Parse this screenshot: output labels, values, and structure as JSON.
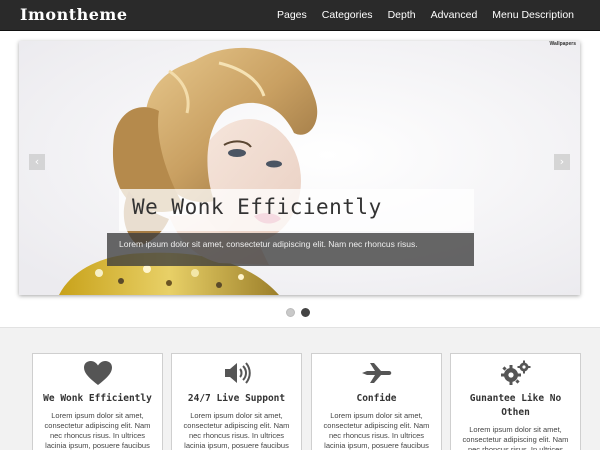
{
  "header": {
    "logo": "Imontheme",
    "nav": [
      "Pages",
      "Categories",
      "Depth",
      "Advanced",
      "Menu Description"
    ]
  },
  "slider": {
    "watermark": "Wallpapers",
    "prev_icon": "chevron-left-icon",
    "next_icon": "chevron-right-icon",
    "caption_title": "We Wonk Efficiently",
    "caption_text": "Lorem ipsum dolor sit amet, consectetur adipiscing elit. Nam nec rhoncus risus.",
    "dots": 2,
    "active_dot": 2
  },
  "services": [
    {
      "icon": "heart-icon",
      "title": "We Wonk Efficiently",
      "text": "Lorem ipsum dolor sit amet, consectetur adipiscing elit. Nam nec rhoncus risus. In ultrices lacinia ipsum, posuere faucibus velit"
    },
    {
      "icon": "speaker-icon",
      "title": "24/7 Live Suppont",
      "text": "Lorem ipsum dolor sit amet, consectetur adipiscing elit. Nam nec rhoncus risus. In ultrices lacinia ipsum, posuere faucibus velit"
    },
    {
      "icon": "airplane-icon",
      "title": "Confide",
      "text": "Lorem ipsum dolor sit amet, consectetur adipiscing elit. Nam nec rhoncus risus. In ultrices lacinia ipsum, posuere faucibus velit"
    },
    {
      "icon": "gears-icon",
      "title": "Gunantee Like No Othen",
      "text": "Lorem ipsum dolor sit amet, consectetur adipiscing elit. Nam nec rhoncus risus. In ultrices lacinia"
    }
  ],
  "colors": {
    "header_bg": "#2a2a2a",
    "band_bg": "#f2f2f2",
    "icon": "#444444"
  }
}
